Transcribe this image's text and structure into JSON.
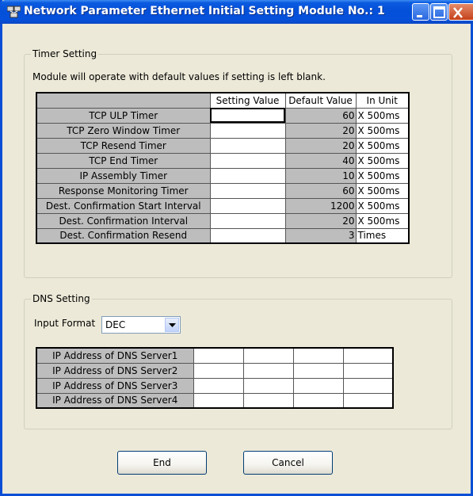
{
  "window": {
    "title": "Network Parameter  Ethernet Initial Setting Module No.: 1",
    "controls": [
      "minimize-icon",
      "maximize-icon",
      "close-icon"
    ],
    "colors": {
      "titlebar": "#0551dc",
      "frame": "#ece9d8"
    }
  },
  "timer_setting": {
    "legend": "Timer Setting",
    "note": "Module will operate with default values if setting is left blank.",
    "columns": [
      "Setting Value",
      "Default Value",
      "In Unit"
    ],
    "rows": [
      {
        "label": "TCP ULP Timer",
        "setting": "",
        "default": "60",
        "unit": "X 500ms"
      },
      {
        "label": "TCP Zero Window Timer",
        "setting": "",
        "default": "20",
        "unit": "X 500ms"
      },
      {
        "label": "TCP Resend Timer",
        "setting": "",
        "default": "20",
        "unit": "X 500ms"
      },
      {
        "label": "TCP End Timer",
        "setting": "",
        "default": "40",
        "unit": "X 500ms"
      },
      {
        "label": "IP Assembly Timer",
        "setting": "",
        "default": "10",
        "unit": "X 500ms"
      },
      {
        "label": "Response Monitoring Timer",
        "setting": "",
        "default": "60",
        "unit": "X 500ms"
      },
      {
        "label": "Dest. Confirmation Start Interval",
        "setting": "",
        "default": "1200",
        "unit": "X 500ms"
      },
      {
        "label": "Dest. Confirmation Interval",
        "setting": "",
        "default": "20",
        "unit": "X 500ms"
      },
      {
        "label": "Dest. Confirmation Resend",
        "setting": "",
        "default": "3",
        "unit": "Times"
      }
    ]
  },
  "dns_setting": {
    "legend": "DNS Setting",
    "input_format_label": "Input Format",
    "input_format_value": "DEC",
    "rows": [
      {
        "label": "IP Address of DNS Server1",
        "octets": [
          "",
          "",
          "",
          ""
        ]
      },
      {
        "label": "IP Address of DNS Server2",
        "octets": [
          "",
          "",
          "",
          ""
        ]
      },
      {
        "label": "IP Address of DNS Server3",
        "octets": [
          "",
          "",
          "",
          ""
        ]
      },
      {
        "label": "IP Address of DNS Server4",
        "octets": [
          "",
          "",
          "",
          ""
        ]
      }
    ]
  },
  "buttons": {
    "end": "End",
    "cancel": "Cancel"
  }
}
